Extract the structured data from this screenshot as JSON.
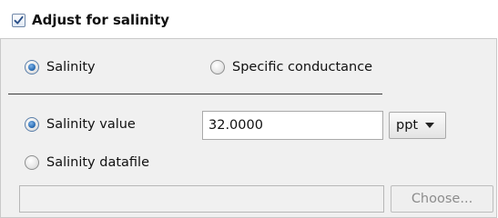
{
  "header": {
    "checkbox_checked": true,
    "label": "Adjust for salinity"
  },
  "mode": {
    "options": [
      {
        "label": "Salinity",
        "selected": true
      },
      {
        "label": "Specific conductance",
        "selected": false
      }
    ]
  },
  "source": {
    "value_option": {
      "label": "Salinity value",
      "selected": true
    },
    "value": "32.0000",
    "unit": "ppt",
    "datafile_option": {
      "label": "Salinity datafile",
      "selected": false
    },
    "datafile_path": "",
    "choose_label": "Choose..."
  },
  "colors": {
    "panel_bg": "#f0f0f0",
    "radio_selected": "#2d6fb6",
    "check_mark": "#2a4f88"
  }
}
